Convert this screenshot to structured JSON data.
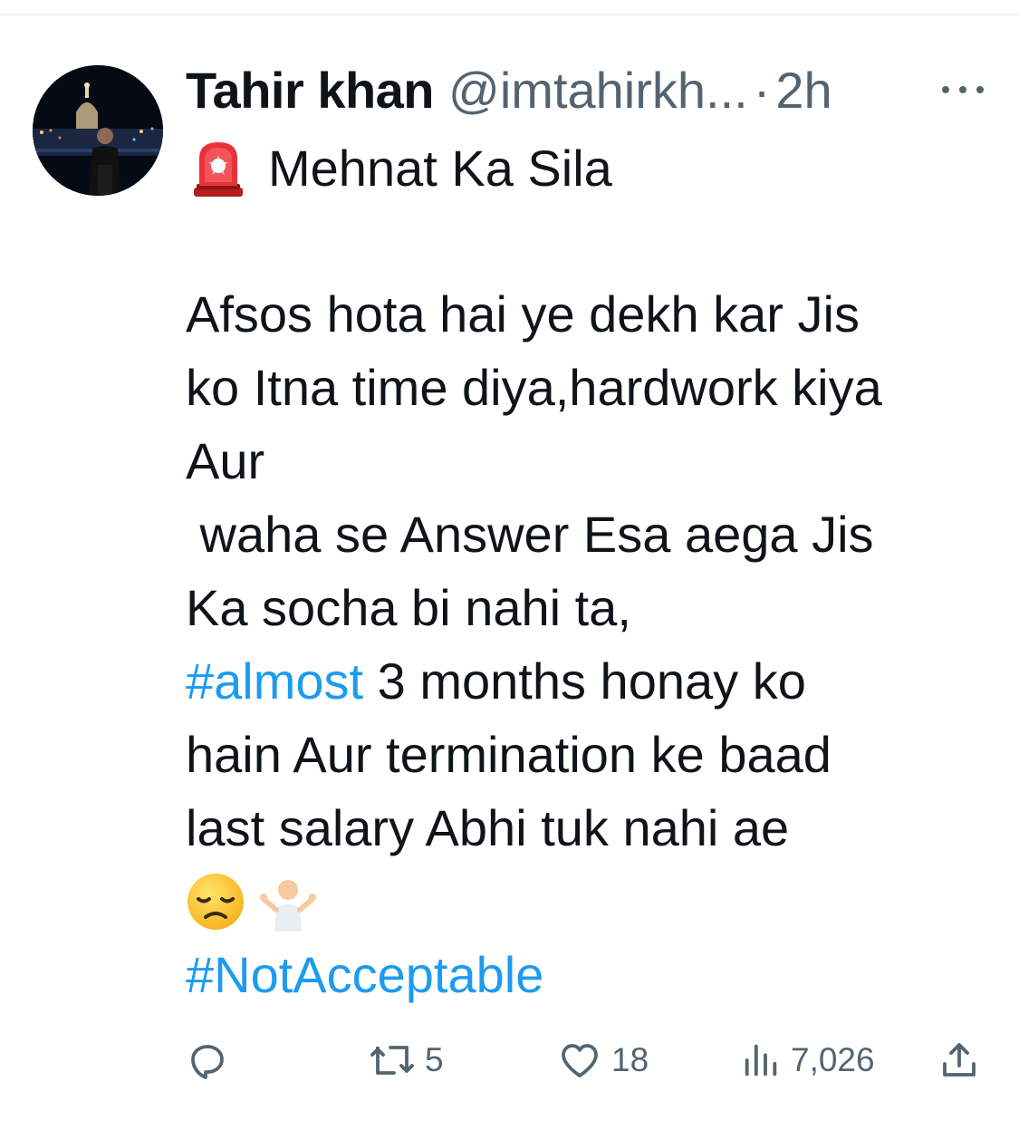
{
  "author": {
    "name": "Tahir khan",
    "handle": "@imtahirkh...",
    "separator": "·",
    "time": "2h"
  },
  "tweet": {
    "title_icon": "police-siren-emoji",
    "title": "Mehnat Ka Sila",
    "lines": [
      "Afsos hota hai ye dekh kar Jis",
      "ko Itna time diya,hardwork kiya",
      "Aur",
      " waha se Answer Esa aega Jis",
      "Ka socha bi nahi ta,"
    ],
    "hashtag_almost": "#almost",
    "line_after_hashtag": " 3 months honay ko",
    "lines_after": [
      "hain Aur termination ke baad",
      "last salary Abhi tuk nahi ae"
    ],
    "emojis": [
      "disappointed-face-emoji",
      "person-shrugging-emoji"
    ],
    "hashtag_final": "#NotAcceptable"
  },
  "actions": {
    "reply_icon": "reply-icon",
    "retweet_icon": "retweet-icon",
    "retweet_count": "5",
    "like_icon": "heart-icon",
    "like_count": "18",
    "views_icon": "views-icon",
    "views_count": "7,026",
    "share_icon": "share-icon"
  },
  "colors": {
    "text": "#0f1419",
    "secondary": "#536471",
    "link": "#1d9bf0",
    "divider": "#eff3f4"
  }
}
